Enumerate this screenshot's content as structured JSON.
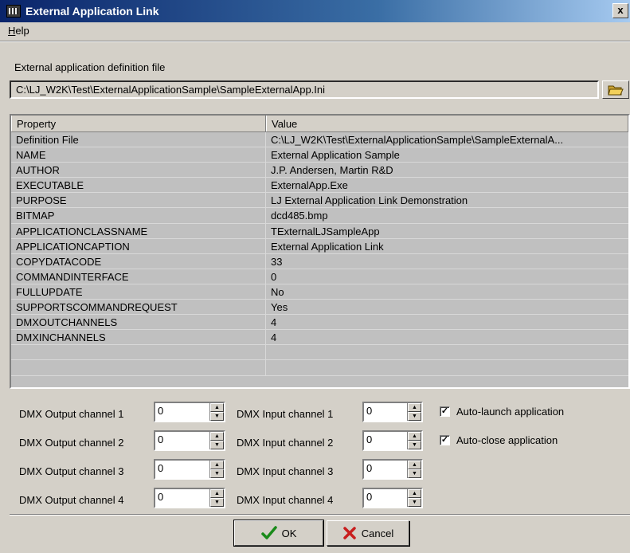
{
  "window": {
    "title": "External Application Link",
    "close_label": "x"
  },
  "menu": {
    "help_mnemonic": "H",
    "help_rest": "elp"
  },
  "file": {
    "label": "External application definition file",
    "value": "C:\\LJ_W2K\\Test\\ExternalApplicationSample\\SampleExternalApp.Ini"
  },
  "grid": {
    "headers": [
      "Property",
      "Value"
    ],
    "rows": [
      [
        "Definition File",
        "C:\\LJ_W2K\\Test\\ExternalApplicationSample\\SampleExternalA..."
      ],
      [
        "NAME",
        "External Application Sample"
      ],
      [
        "AUTHOR",
        "J.P. Andersen, Martin R&D"
      ],
      [
        "EXECUTABLE",
        "ExternalApp.Exe"
      ],
      [
        "PURPOSE",
        "LJ External Application Link Demonstration"
      ],
      [
        "BITMAP",
        "dcd485.bmp"
      ],
      [
        "APPLICATIONCLASSNAME",
        "TExternalLJSampleApp"
      ],
      [
        "APPLICATIONCAPTION",
        "External Application Link"
      ],
      [
        "COPYDATACODE",
        "33"
      ],
      [
        "COMMANDINTERFACE",
        "0"
      ],
      [
        "FULLUPDATE",
        "No"
      ],
      [
        "SUPPORTSCOMMANDREQUEST",
        "Yes"
      ],
      [
        "DMXOUTCHANNELS",
        "4"
      ],
      [
        "DMXINCHANNELS",
        "4"
      ]
    ]
  },
  "dmx": {
    "outputs": [
      {
        "label": "DMX Output channel 1",
        "value": "0"
      },
      {
        "label": "DMX Output channel 2",
        "value": "0"
      },
      {
        "label": "DMX Output channel 3",
        "value": "0"
      },
      {
        "label": "DMX Output channel 4",
        "value": "0"
      }
    ],
    "inputs": [
      {
        "label": "DMX Input channel 1",
        "value": "0"
      },
      {
        "label": "DMX Input channel 2",
        "value": "0"
      },
      {
        "label": "DMX Input channel 3",
        "value": "0"
      },
      {
        "label": "DMX Input channel 4",
        "value": "0"
      }
    ]
  },
  "options": {
    "auto_launch": {
      "label": "Auto-launch application",
      "checked": true
    },
    "auto_close": {
      "label": "Auto-close application",
      "checked": true
    }
  },
  "buttons": {
    "ok": "OK",
    "cancel": "Cancel"
  },
  "icons": {
    "app": "lighting-console-icon",
    "folder": "folder-open-icon",
    "ok": "checkmark-icon",
    "cancel": "x-mark-icon"
  },
  "colors": {
    "ok_check": "#1a8a1a",
    "cancel_x": "#c81e1e",
    "title_bar": "#0a246a",
    "folder": "#f2d05a"
  }
}
